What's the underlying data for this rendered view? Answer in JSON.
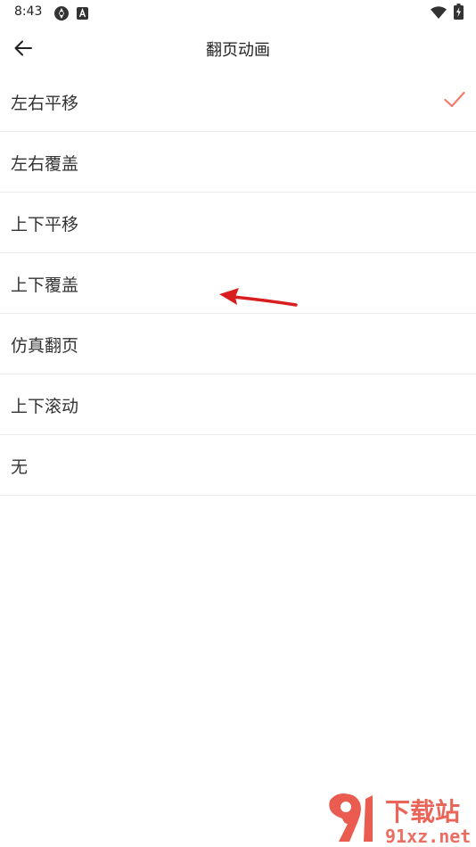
{
  "status_bar": {
    "time": "8:43"
  },
  "app_bar": {
    "title": "翻页动画"
  },
  "options": [
    {
      "label": "左右平移",
      "selected": true
    },
    {
      "label": "左右覆盖",
      "selected": false
    },
    {
      "label": "上下平移",
      "selected": false
    },
    {
      "label": "上下覆盖",
      "selected": false
    },
    {
      "label": "仿真翻页",
      "selected": false
    },
    {
      "label": "上下滚动",
      "selected": false
    },
    {
      "label": "无",
      "selected": false
    }
  ],
  "colors": {
    "accent": "#f27a6b",
    "annotation_arrow": "#d81e1e",
    "divider": "#ececec",
    "text": "#333333"
  },
  "watermark": {
    "text_top": "下载站",
    "text_bottom": "91xz.net"
  }
}
